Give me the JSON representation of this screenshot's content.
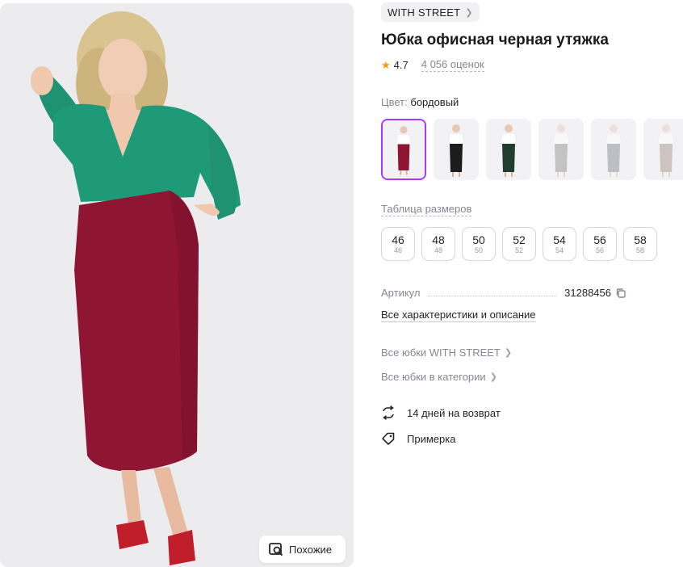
{
  "product": {
    "brand": "WITH STREET",
    "title": "Юбка офисная черная утяжка",
    "rating": "4.7",
    "reviews": "4 056 оценок",
    "color_label": "Цвет:",
    "color_value": "бордовый",
    "colors": [
      {
        "name": "бордовый",
        "skirt": "#8e1633",
        "active": true
      },
      {
        "name": "черный",
        "skirt": "#1c1c1c",
        "active": false
      },
      {
        "name": "зеленый",
        "skirt": "#1f3d30",
        "active": false
      },
      {
        "name": "серый",
        "skirt": "#8a8a8a",
        "active": false
      },
      {
        "name": "серо-голубой",
        "skirt": "#7c828e",
        "active": false
      },
      {
        "name": "бежевый",
        "skirt": "#a08a80",
        "active": false
      }
    ],
    "size_table_label": "Таблица размеров",
    "sizes": [
      {
        "ru": "46",
        "sub": "46"
      },
      {
        "ru": "48",
        "sub": "48"
      },
      {
        "ru": "50",
        "sub": "50"
      },
      {
        "ru": "52",
        "sub": "52"
      },
      {
        "ru": "54",
        "sub": "54"
      },
      {
        "ru": "56",
        "sub": "56"
      },
      {
        "ru": "58",
        "sub": "58"
      }
    ],
    "article_label": "Артикул",
    "article_value": "31288456",
    "all_specs": "Все характеристики и описание",
    "links": [
      "Все юбки WITH STREET",
      "Все юбки в категории"
    ],
    "features": [
      {
        "icon": "return-arrows-icon",
        "label": "14 дней на возврат"
      },
      {
        "icon": "tag-icon",
        "label": "Примерка"
      }
    ]
  },
  "photo": {
    "similar_label": "Похожие",
    "icon": "search-image-icon"
  },
  "colors": {
    "accent": "#a73afd",
    "star": "#ff9900",
    "muted_text": "#868695"
  }
}
